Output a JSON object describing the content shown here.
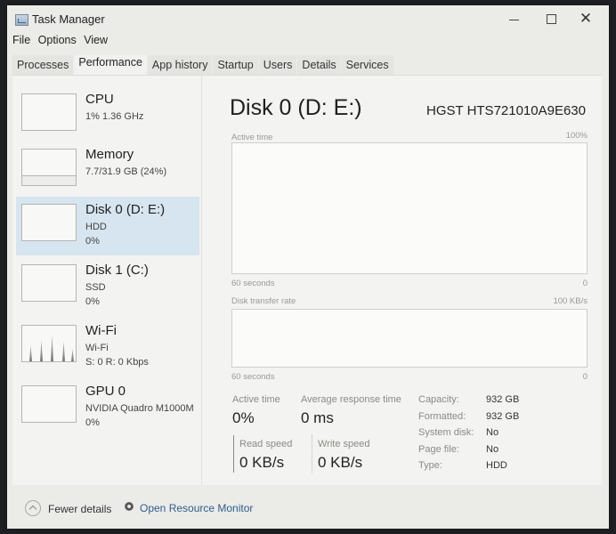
{
  "window": {
    "title": "Task Manager",
    "controls": {
      "minimize": "–",
      "maximize": "☐",
      "close": "✕"
    }
  },
  "menu": [
    "File",
    "Options",
    "View"
  ],
  "tabs": [
    {
      "label": "Processes",
      "active": false
    },
    {
      "label": "Performance",
      "active": true
    },
    {
      "label": "App history",
      "active": false
    },
    {
      "label": "Startup",
      "active": false
    },
    {
      "label": "Users",
      "active": false
    },
    {
      "label": "Details",
      "active": false
    },
    {
      "label": "Services",
      "active": false
    }
  ],
  "sidebar": {
    "items": [
      {
        "name": "CPU",
        "line1": "1%  1.36 GHz",
        "line2": ""
      },
      {
        "name": "Memory",
        "line1": "7.7/31.9 GB (24%)",
        "line2": ""
      },
      {
        "name": "Disk 0 (D: E:)",
        "line1": "HDD",
        "line2": "0%",
        "selected": true
      },
      {
        "name": "Disk 1 (C:)",
        "line1": "SSD",
        "line2": "0%"
      },
      {
        "name": "Wi-Fi",
        "line1": "Wi-Fi",
        "line2": "S: 0  R: 0 Kbps"
      },
      {
        "name": "GPU 0",
        "line1": "NVIDIA Quadro M1000M",
        "line2": "0%"
      }
    ]
  },
  "main": {
    "title": "Disk 0 (D: E:)",
    "model": "HGST HTS721010A9E630",
    "active_time_graph": {
      "label": "Active time",
      "max": "100%",
      "time_span": "60 seconds",
      "min": "0"
    },
    "transfer_graph": {
      "label": "Disk transfer rate",
      "max": "100 KB/s",
      "time_span": "60 seconds",
      "min": "0"
    },
    "stats": {
      "active_time_label": "Active time",
      "active_time_value": "0%",
      "avg_response_label": "Average response time",
      "avg_response_value": "0 ms",
      "read_speed_label": "Read speed",
      "read_speed_value": "0 KB/s",
      "write_speed_label": "Write speed",
      "write_speed_value": "0 KB/s"
    },
    "properties": [
      {
        "label": "Capacity:",
        "value": "932 GB"
      },
      {
        "label": "Formatted:",
        "value": "932 GB"
      },
      {
        "label": "System disk:",
        "value": "No"
      },
      {
        "label": "Page file:",
        "value": "No"
      },
      {
        "label": "Type:",
        "value": "HDD"
      }
    ]
  },
  "footer": {
    "fewer_details": "Fewer details",
    "resource_monitor": "Open Resource Monitor"
  }
}
